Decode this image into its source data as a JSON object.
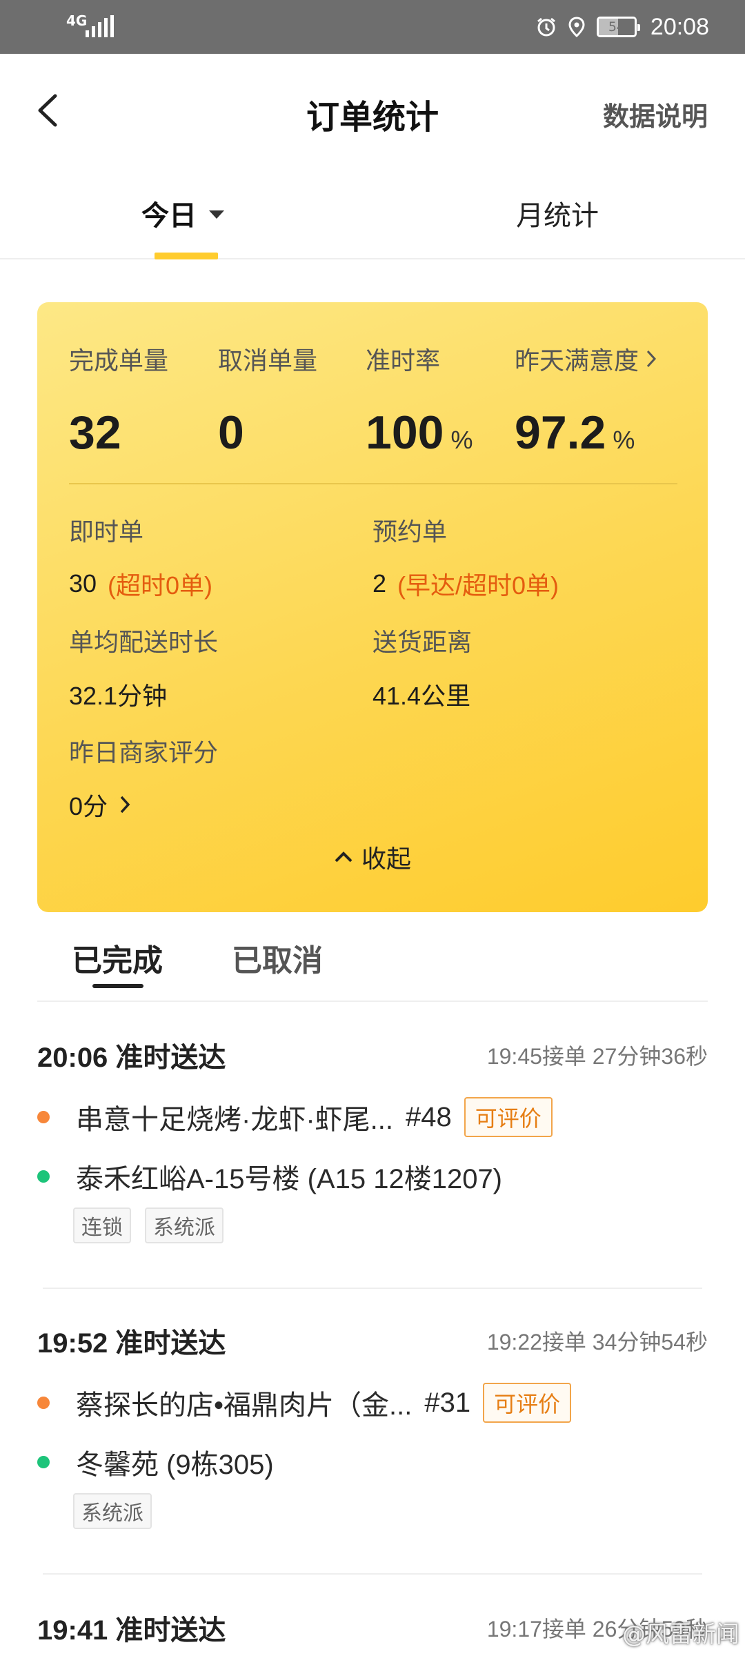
{
  "status_bar": {
    "network": "4G",
    "battery": "54",
    "time": "20:08",
    "icons": [
      "alarm-icon",
      "location-icon",
      "battery-icon"
    ]
  },
  "nav": {
    "title": "订单统计",
    "right_link": "数据说明"
  },
  "tabs": {
    "today": "今日",
    "month": "月统计"
  },
  "stats": {
    "completed": {
      "label": "完成单量",
      "value": "32"
    },
    "cancelled": {
      "label": "取消单量",
      "value": "0"
    },
    "ontime": {
      "label": "准时率",
      "value": "100",
      "unit": "%"
    },
    "satisfaction": {
      "label": "昨天满意度",
      "value": "97.2",
      "unit": "%"
    }
  },
  "details": {
    "instant": {
      "label": "即时单",
      "value": "30",
      "note": "(超时0单)"
    },
    "reserved": {
      "label": "预约单",
      "value": "2",
      "note": "(早达/超时0单)"
    },
    "avg_time": {
      "label": "单均配送时长",
      "value": "32.1分钟"
    },
    "distance": {
      "label": "送货距离",
      "value": "41.4公里"
    },
    "merchant_score": {
      "label": "昨日商家评分",
      "value": "0分"
    }
  },
  "collapse_label": "收起",
  "order_tabs": {
    "done": "已完成",
    "cancelled": "已取消"
  },
  "orders": [
    {
      "status": "20:06 准时送达",
      "meta": "19:45接单 27分钟36秒",
      "shop": "串意十足烧烤·龙虾·虾尾...",
      "num": "#48",
      "rate": "可评价",
      "address": "泰禾红峪A-15号楼 (A15 12楼1207)",
      "tags": [
        "连锁",
        "系统派"
      ]
    },
    {
      "status": "19:52 准时送达",
      "meta": "19:22接单 34分钟54秒",
      "shop": "蔡探长的店•福鼎肉片（金...",
      "num": "#31",
      "rate": "可评价",
      "address": "冬馨苑 (9栋305)",
      "tags": [
        "系统派"
      ]
    },
    {
      "status": "19:41 准时送达",
      "meta": "19:17接单 26分钟59秒"
    }
  ],
  "watermark": "@风雷新闻",
  "colors": {
    "accent_yellow": "#ffcc2e",
    "warning_orange": "#e45c0f",
    "shop_dot": "#f7873a",
    "address_dot": "#1dc47a"
  }
}
